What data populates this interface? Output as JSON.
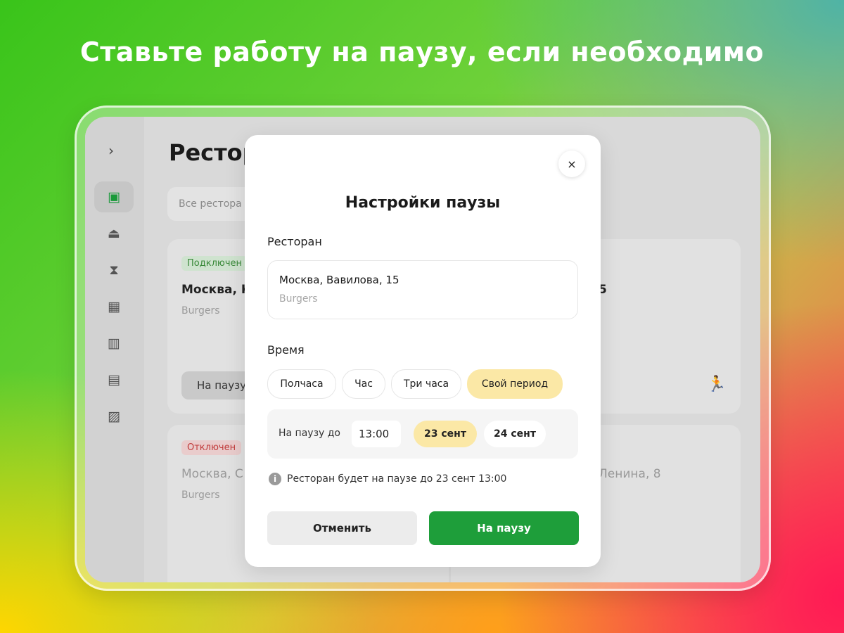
{
  "headline": "Ставьте работу на паузу, если необходимо",
  "app": {
    "sidebar_toggle": "›",
    "page_title": "Рестор",
    "filter_placeholder": "Все рестора",
    "cards": [
      {
        "status": "Подключен",
        "address": "Москва, К",
        "cuisine": "Burgers",
        "pause_label": "На паузу"
      },
      {
        "address_fragment": "5"
      },
      {
        "status": "Отключен",
        "address": "Москва, С",
        "cuisine": "Burgers"
      },
      {
        "address_fragment": "Ленина, 8"
      }
    ]
  },
  "modal": {
    "close": "×",
    "title": "Настройки паузы",
    "restaurant_label": "Ресторан",
    "restaurant": {
      "name": "Москва, Вавилова, 15",
      "cuisine": "Burgers"
    },
    "time_label": "Время",
    "chips": [
      {
        "label": "Полчаса",
        "selected": false
      },
      {
        "label": "Час",
        "selected": false
      },
      {
        "label": "Три часа",
        "selected": false
      },
      {
        "label": "Свой период",
        "selected": true
      }
    ],
    "range": {
      "label": "На паузу до",
      "time": "13:00",
      "dates": [
        {
          "label": "23 сент",
          "selected": true
        },
        {
          "label": "24 сент",
          "selected": false
        }
      ]
    },
    "info_icon": "i",
    "info_text": "Ресторан будет на паузе до 23 сент 13:00",
    "cancel_label": "Отменить",
    "confirm_label": "На паузу"
  },
  "colors": {
    "accent_green": "#1e9e3a",
    "selected_chip": "#fbe8a6"
  }
}
